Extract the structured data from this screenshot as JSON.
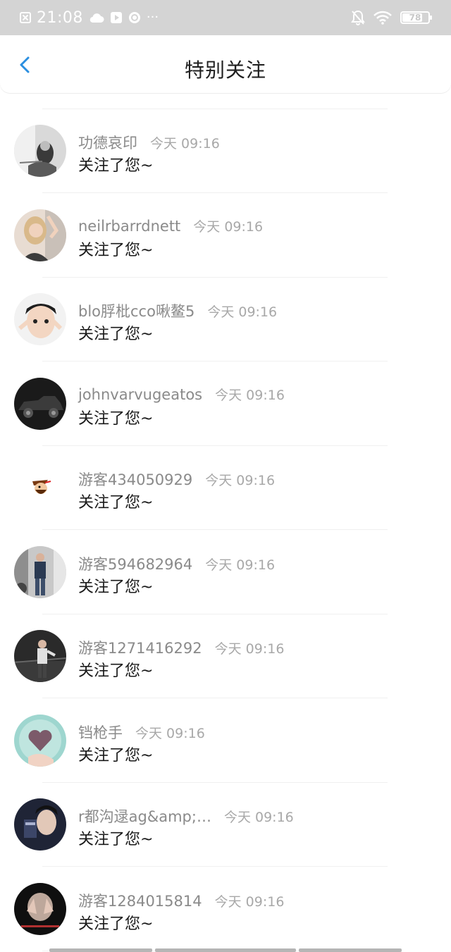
{
  "status_bar": {
    "time": "21:08",
    "battery": "78",
    "battery_level": 0.78,
    "left_icons": [
      "notification-blocked-icon",
      "cloud-icon",
      "video-icon",
      "app-icon",
      "more-dots-icon"
    ],
    "right_icons": [
      "mute-bell-icon",
      "wifi-icon",
      "battery-icon"
    ]
  },
  "header": {
    "title": "特别关注",
    "back_icon": "back-chevron-icon",
    "accent_color": "#2b8fe0"
  },
  "items": [
    {
      "username": "功德哀印",
      "time": "今天 09:16",
      "action": "关注了您~",
      "avatar": "avatar-woman-bw"
    },
    {
      "username": "neilrbarrdnett",
      "time": "今天 09:16",
      "action": "关注了您~",
      "avatar": "avatar-woman-blonde"
    },
    {
      "username": "blo脬枇cco啾鳌5",
      "time": "今天 09:16",
      "action": "关注了您~",
      "avatar": "avatar-boy"
    },
    {
      "username": "johnvarvugeatos",
      "time": "今天 09:16",
      "action": "关注了您~",
      "avatar": "avatar-vintage-car"
    },
    {
      "username": "游客434050929",
      "time": "今天 09:16",
      "action": "关注了您~",
      "avatar": "avatar-cartoon-pirate"
    },
    {
      "username": "游客594682964",
      "time": "今天 09:16",
      "action": "关注了您~",
      "avatar": "avatar-man-street"
    },
    {
      "username": "游客1271416292",
      "time": "今天 09:16",
      "action": "关注了您~",
      "avatar": "avatar-man-night"
    },
    {
      "username": "铛枪手",
      "time": "今天 09:16",
      "action": "关注了您~",
      "avatar": "avatar-heart-hand"
    },
    {
      "username": "r都沟逯ag&amp;…",
      "time": "今天 09:16",
      "action": "关注了您~",
      "avatar": "avatar-man-card"
    },
    {
      "username": "游客1284015814",
      "time": "今天 09:16",
      "action": "关注了您~",
      "avatar": "avatar-hands-face"
    }
  ]
}
